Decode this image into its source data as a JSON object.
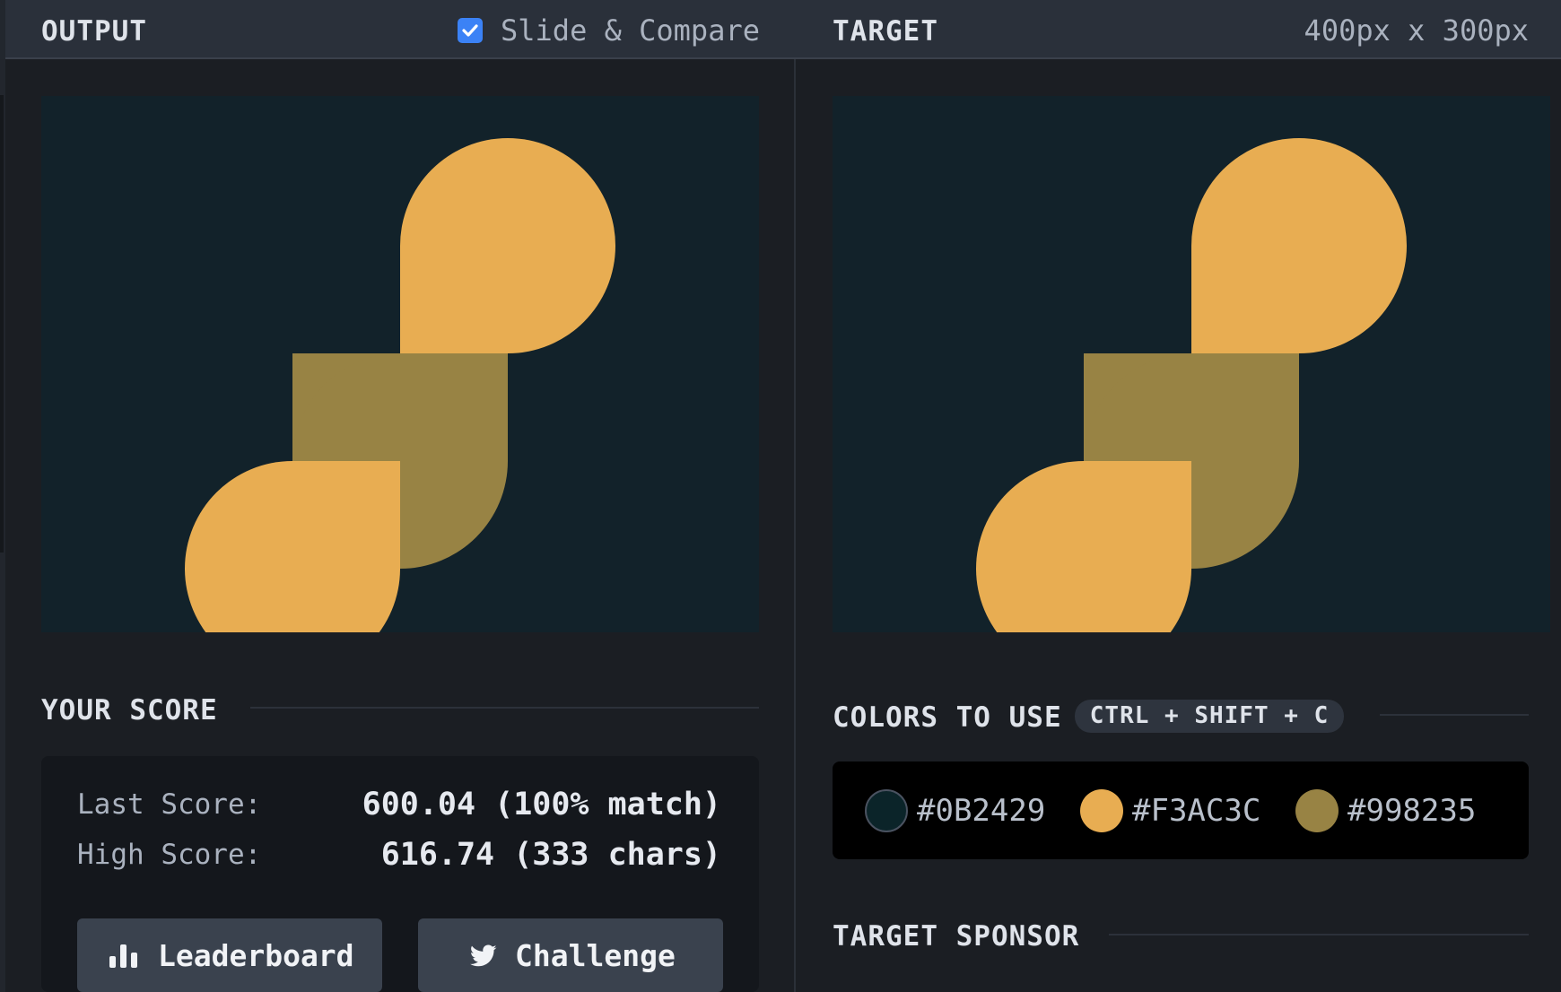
{
  "header": {
    "output_title": "OUTPUT",
    "compare_label": "Slide & Compare",
    "compare_checked": true,
    "target_title": "TARGET",
    "target_size": "400px x 300px"
  },
  "score": {
    "section_title": "YOUR SCORE",
    "last_label": "Last Score:",
    "last_value": "600.04 (100% match)",
    "high_label": "High Score:",
    "high_value": "616.74 (333 chars)",
    "leaderboard_label": "Leaderboard",
    "leaderboard_icon": "bar-chart-icon",
    "challenge_label": "Challenge",
    "challenge_icon": "twitter-icon"
  },
  "colors": {
    "section_title": "COLORS TO USE",
    "shortcut": "CTRL + SHIFT + C",
    "swatches": [
      {
        "hex": "#0B2429"
      },
      {
        "hex": "#F3AC3C"
      },
      {
        "hex": "#998235"
      }
    ]
  },
  "sponsor": {
    "section_title": "TARGET SPONSOR"
  },
  "theme": {
    "canvas_background": "#12222a",
    "shape_yellow": "#e8ad52",
    "shape_olive": "#988344",
    "checkbox_accent": "#3b82f6"
  }
}
